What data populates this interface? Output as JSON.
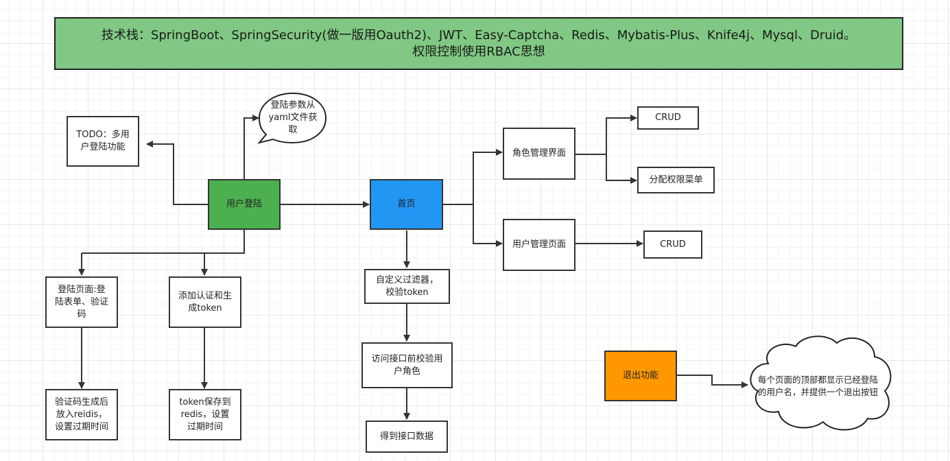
{
  "diagram": {
    "title": {
      "line1": "技术栈：SpringBoot、SpringSecurity(做一版用Oauth2)、JWT、Easy-Captcha、Redis、Mybatis-Plus、Knife4j、Mysql、Druid。",
      "line2": "权限控制使用RBAC思想"
    },
    "colors": {
      "title_fill": "#80c884",
      "login_fill": "#4caf50",
      "home_fill": "#2196f3",
      "logout_fill": "#ff9800",
      "stroke": "#333333"
    },
    "nodes": {
      "todo": "TODO：多用\n户登陆功能",
      "yaml_callout": "登陆参数从\nyaml文件获\n取",
      "user_login": "用户登陆",
      "home": "首页",
      "role_mgmt": "角色管理界面",
      "role_crud": "CRUD",
      "assign_perm": "分配权限菜单",
      "user_mgmt": "用户管理页面",
      "user_crud": "CRUD",
      "login_page": "登陆页面:登\n陆表单、验证\n码",
      "add_auth": "添加认证和生\n成token",
      "captcha_redis": "验证码生成后\n放入reidis，\n设置过期时间",
      "token_redis": "token保存到\nredis，设置\n过期时间",
      "custom_filter": "自定义过滤器，\n校验token",
      "check_role": "访问接口前校验用\n户角色",
      "get_data": "得到接口数据",
      "logout": "退出功能",
      "logout_cloud": "每个页面的顶部都显示已经登陆\n的用户名，并提供一个退出按钮"
    }
  }
}
